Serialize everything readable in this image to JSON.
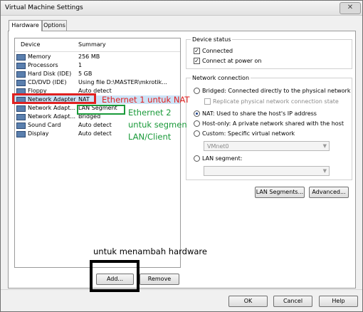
{
  "window": {
    "title": "Virtual Machine Settings",
    "close_glyph": "✕"
  },
  "tabs": [
    {
      "label": "Hardware"
    },
    {
      "label": "Options"
    }
  ],
  "device_list": {
    "col_device": "Device",
    "col_summary": "Summary",
    "rows": [
      {
        "device": "Memory",
        "summary": "256 MB",
        "icon": "memory-icon"
      },
      {
        "device": "Processors",
        "summary": "1",
        "icon": "processor-icon"
      },
      {
        "device": "Hard Disk (IDE)",
        "summary": "5 GB",
        "icon": "hard-disk-icon"
      },
      {
        "device": "CD/DVD (IDE)",
        "summary": "Using file D:\\MASTER\\mkrotik...",
        "icon": "cd-dvd-icon"
      },
      {
        "device": "Floppy",
        "summary": "Auto detect",
        "icon": "floppy-icon"
      },
      {
        "device": "Network Adapter",
        "summary": "NAT",
        "icon": "network-adapter-icon"
      },
      {
        "device": "Network Adapt...",
        "summary": "LAN Segment",
        "icon": "network-adapter-icon"
      },
      {
        "device": "Network Adapt...",
        "summary": "Bridged",
        "icon": "network-adapter-icon"
      },
      {
        "device": "Sound Card",
        "summary": "Auto detect",
        "icon": "sound-card-icon"
      },
      {
        "device": "Display",
        "summary": "Auto detect",
        "icon": "display-icon"
      }
    ]
  },
  "device_status": {
    "legend": "Device status",
    "connected": "Connected",
    "connect_at_power_on": "Connect at power on"
  },
  "network_connection": {
    "legend": "Network connection",
    "bridged": "Bridged: Connected directly to the physical network",
    "replicate": "Replicate physical network connection state",
    "nat": "NAT: Used to share the host's IP address",
    "host_only": "Host-only: A private network shared with the host",
    "custom": "Custom: Specific virtual network",
    "custom_value": "VMnet0",
    "lan_segment": "LAN segment:",
    "lan_segment_value": ""
  },
  "buttons": {
    "lan_segments": "LAN Segments...",
    "advanced": "Advanced...",
    "add": "Add...",
    "remove": "Remove",
    "ok": "OK",
    "cancel": "Cancel",
    "help": "Help"
  },
  "annotations": {
    "eth1": "Ethernet 1 untuk NAT",
    "eth2_line1": "Ethernet 2",
    "eth2_line2": "untuk segmen",
    "eth2_line3": "LAN/Client",
    "add_hw": "untuk menambah hardware"
  },
  "colors": {
    "annotation_red": "#e02020",
    "annotation_green": "#1a9a3a",
    "selection": "#cde3f7"
  }
}
